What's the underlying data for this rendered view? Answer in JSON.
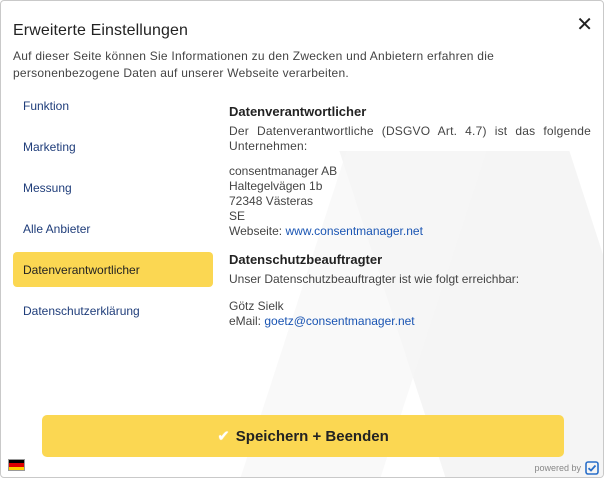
{
  "dialog": {
    "title": "Erweiterte Einstellungen",
    "close_symbol": "✕",
    "intro": "Auf dieser Seite können Sie Informationen zu den Zwecken und Anbietern erfahren die personenbezogene Daten auf unserer Webseite verarbeiten."
  },
  "nav": {
    "items": [
      {
        "label": "Funktion"
      },
      {
        "label": "Marketing"
      },
      {
        "label": "Messung"
      },
      {
        "label": "Alle Anbieter"
      },
      {
        "label": "Datenverantwortlicher"
      },
      {
        "label": "Datenschutzerklärung"
      }
    ],
    "active_index": 4
  },
  "content": {
    "section1": {
      "heading": "Datenverantwortlicher",
      "text": "Der Datenverantwortliche (DSGVO Art. 4.7) ist das folgende Unternehmen:",
      "address": [
        "consentmanager AB",
        "Haltegelvägen 1b",
        "72348 Västeras",
        "SE"
      ],
      "website_label": "Webseite: ",
      "website_link": "www.consentmanager.net"
    },
    "section2": {
      "heading": "Datenschutzbeauftragter",
      "text": "Unser Datenschutzbeauftragter ist wie folgt erreichbar:",
      "name": "Götz Sielk",
      "email_label": "eMail: ",
      "email_link": "goetz@consentmanager.net"
    }
  },
  "footer": {
    "save_label": "Speichern + Beenden",
    "check_icon": "✔",
    "powered_by": "powered by",
    "language_flag": "de-flag-icon"
  },
  "colors": {
    "accent": "#fbd752",
    "link": "#1a55b3",
    "nav_text": "#1f3d7a"
  }
}
